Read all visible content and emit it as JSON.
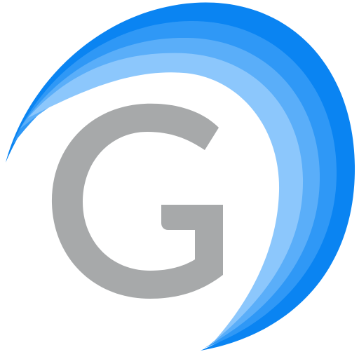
{
  "logo": {
    "letter": "G",
    "icon": "g-swirl-logo",
    "colors": {
      "letter_gray": "#A7A9AA",
      "swirl_1": "#0A84F2",
      "swirl_2": "#2F98F6",
      "swirl_3": "#5AAEF9",
      "swirl_4": "#8CC7FC"
    }
  }
}
